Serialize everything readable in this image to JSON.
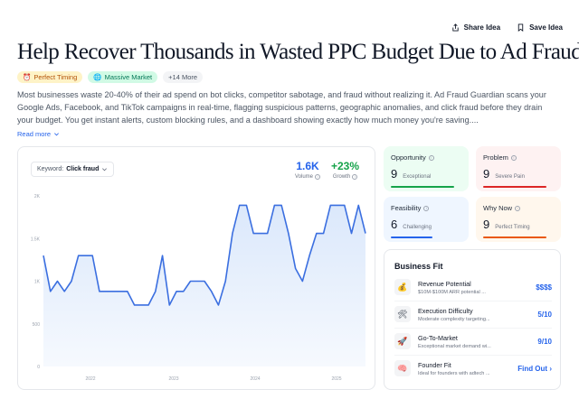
{
  "header": {
    "share_label": "Share Idea",
    "save_label": "Save Idea"
  },
  "title": "Help Recover Thousands in Wasted PPC Budget Due to Ad Fraud",
  "tags": [
    {
      "label": "Perfect Timing",
      "icon": "alarm-clock-icon"
    },
    {
      "label": "Massive Market",
      "icon": "globe-icon"
    },
    {
      "label": "+14 More"
    }
  ],
  "description": "Most businesses waste 20-40% of their ad spend on bot clicks, competitor sabotage, and fraud without realizing it. Ad Fraud Guardian scans your Google Ads, Facebook, and TikTok campaigns in real-time, flagging suspicious patterns, geographic anomalies, and click fraud before they drain your budget. You get instant alerts, custom blocking rules, and a dashboard showing exactly how much money you're saving....",
  "read_more": "Read more",
  "keyword": {
    "prefix": "Keyword:",
    "value": "Click fraud"
  },
  "metrics": {
    "volume": {
      "value": "1.6K",
      "label": "Volume",
      "color": "#2563eb"
    },
    "growth": {
      "value": "+23%",
      "label": "Growth",
      "color": "#16a34a"
    }
  },
  "chart_data": {
    "type": "area",
    "x_ticks": [
      "2022",
      "2023",
      "2024",
      "2025"
    ],
    "y_ticks": [
      "0",
      "500",
      "1K",
      "1.5K",
      "2K"
    ],
    "ylim": [
      0,
      2000
    ],
    "values": [
      1300,
      880,
      1000,
      880,
      1000,
      1300,
      1300,
      1300,
      880,
      880,
      880,
      880,
      880,
      720,
      720,
      720,
      880,
      1300,
      720,
      880,
      880,
      1000,
      1000,
      1000,
      880,
      720,
      1000,
      1560,
      1890,
      1890,
      1560,
      1560,
      1560,
      1890,
      1890,
      1560,
      1150,
      1000,
      1300,
      1560,
      1560,
      1890,
      1890,
      1890,
      1560,
      1890,
      1560
    ],
    "line_color": "#3b6fe0",
    "fill_color": "#dbe8fb"
  },
  "scores": [
    {
      "title": "Opportunity",
      "value": "9",
      "sub": "Exceptional",
      "bg": "#ecfdf3",
      "bar": "#16a34a"
    },
    {
      "title": "Problem",
      "value": "9",
      "sub": "Severe Pain",
      "bg": "#fef2f2",
      "bar": "#dc2626"
    },
    {
      "title": "Feasibility",
      "value": "6",
      "sub": "Challenging",
      "bg": "#eff6ff",
      "bar": "#2563eb"
    },
    {
      "title": "Why Now",
      "value": "9",
      "sub": "Perfect Timing",
      "bg": "#fff7ed",
      "bar": "#ea580c"
    }
  ],
  "business_fit": {
    "title": "Business Fit",
    "rows": [
      {
        "icon": "money-bag-icon",
        "glyph": "💰",
        "label": "Revenue Potential",
        "desc": "$10M-$100M ARR potential ...",
        "value": "$$$$"
      },
      {
        "icon": "tools-icon",
        "glyph": "🛠",
        "label": "Execution Difficulty",
        "desc": "Moderate complexity targeting...",
        "value": "5/10"
      },
      {
        "icon": "rocket-icon",
        "glyph": "🚀",
        "label": "Go-To-Market",
        "desc": "Exceptional market demand wi...",
        "value": "9/10"
      },
      {
        "icon": "brain-icon",
        "glyph": "🧠",
        "label": "Founder Fit",
        "desc": "Ideal for founders with adtech ...",
        "value": "Find Out"
      }
    ]
  }
}
